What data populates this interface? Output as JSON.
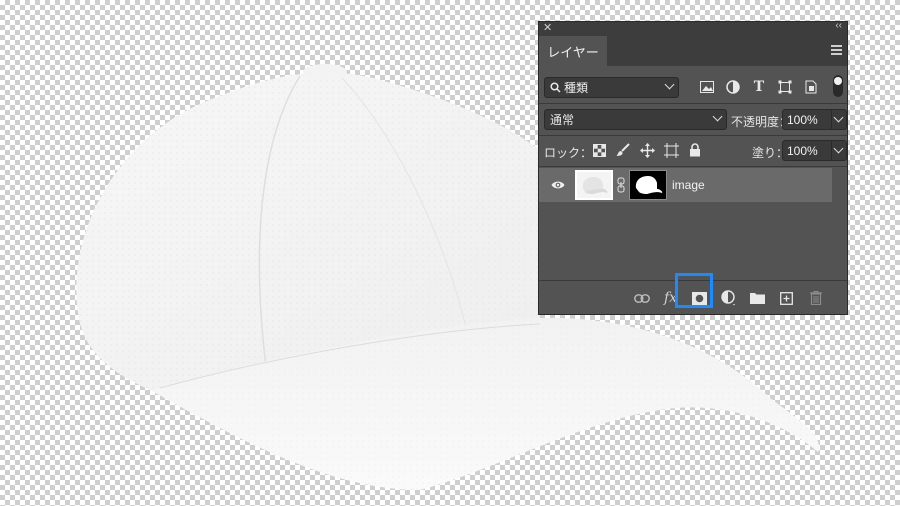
{
  "panel": {
    "tab_label": "レイヤー",
    "filter": {
      "selected": "種類"
    },
    "blend_mode": {
      "selected": "通常"
    },
    "opacity": {
      "label": "不透明度：",
      "value": "100%"
    },
    "lock": {
      "label": "ロック："
    },
    "fill": {
      "label": "塗り：",
      "value": "100%"
    },
    "layers": [
      {
        "name": "image",
        "visible": true,
        "has_mask": true,
        "selected": true
      }
    ],
    "bottom_icons": [
      "link-layers-icon",
      "fx-icon",
      "add-mask-icon",
      "adjustment-layer-icon",
      "group-folder-icon",
      "new-layer-icon",
      "trash-icon"
    ]
  },
  "colors": {
    "panel_bg": "#535353",
    "highlight": "#1a8cff",
    "selected_row": "#6a6a6a"
  }
}
